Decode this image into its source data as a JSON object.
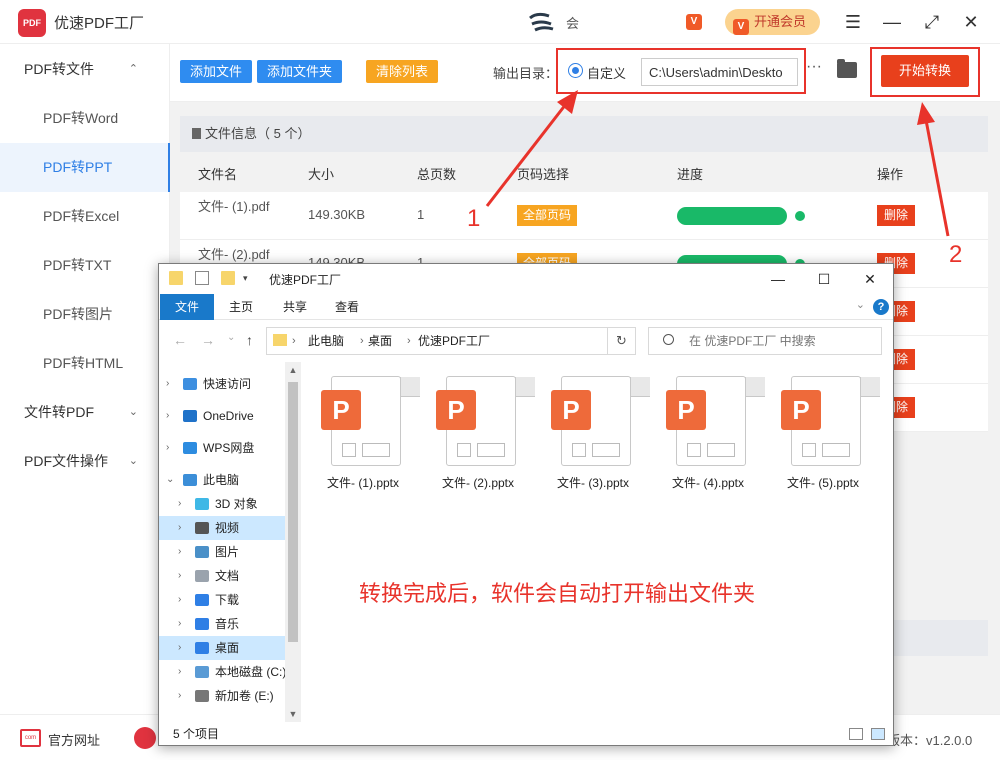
{
  "app": {
    "title": "优速PDF工厂",
    "logo_text": "PDF",
    "user_name": "会",
    "vip_label": "开通会员",
    "vip_icon": "V"
  },
  "window_controls": {
    "menu": "☰",
    "minimize": "—",
    "maximize": "⤢",
    "close": "✕"
  },
  "sidebar": {
    "groups": [
      {
        "label": "PDF转文件",
        "chevron": "⌃"
      },
      {
        "label": "文件转PDF",
        "chevron": "⌄"
      },
      {
        "label": "PDF文件操作",
        "chevron": "⌄"
      }
    ],
    "items": [
      {
        "label": "PDF转Word"
      },
      {
        "label": "PDF转PPT"
      },
      {
        "label": "PDF转Excel"
      },
      {
        "label": "PDF转TXT"
      },
      {
        "label": "PDF转图片"
      },
      {
        "label": "PDF转HTML"
      }
    ]
  },
  "toolbar": {
    "add_file": "添加文件",
    "add_folder": "添加文件夹",
    "clear_list": "清除列表",
    "output_label": "输出目录：",
    "custom_label": "自定义",
    "output_path": "C:\\Users\\admin\\Deskto",
    "more": "···",
    "start": "开始转换"
  },
  "file_list": {
    "info_title": "文件信息（ 5 个）",
    "headers": [
      "文件名",
      "大小",
      "总页数",
      "页码选择",
      "进度",
      "操作"
    ],
    "rows": [
      {
        "name": "文件- (1).pdf",
        "size": "149.30KB",
        "pages": "1",
        "page_select": "全部页码",
        "progress": 1.0,
        "action": "删除"
      },
      {
        "name": "文件- (2).pdf",
        "size": "149.30KB",
        "pages": "1",
        "page_select": "全部页码",
        "progress": 1.0,
        "action": "删除"
      }
    ],
    "hidden_row_actions": [
      "删除",
      "删除",
      "删除"
    ]
  },
  "status_bar": {
    "site_icon": "com",
    "site_link": "官方网址",
    "version": "版本：v1.2.0.0"
  },
  "explorer": {
    "title": "优速PDF工厂",
    "ribbon_tabs": [
      "文件",
      "主页",
      "共享",
      "查看"
    ],
    "help": "?",
    "breadcrumb": [
      "此电脑",
      "桌面",
      "优速PDF工厂"
    ],
    "search_placeholder": "在 优速PDF工厂 中搜索",
    "tree": [
      {
        "label": "快速访问",
        "icon": "star-icon",
        "color": "#3d8fe0"
      },
      {
        "label": "OneDrive",
        "icon": "cloud-icon",
        "color": "#1f72c9"
      },
      {
        "label": "WPS网盘",
        "icon": "cloud-icon",
        "color": "#2d8ce0"
      },
      {
        "label": "此电脑",
        "icon": "computer-icon",
        "color": "#3b8ed8"
      },
      {
        "label": "3D 对象",
        "icon": "cube-icon",
        "color": "#3fb8e6"
      },
      {
        "label": "视频",
        "icon": "film-icon",
        "color": "#555555"
      },
      {
        "label": "图片",
        "icon": "image-icon",
        "color": "#4a90c8"
      },
      {
        "label": "文档",
        "icon": "document-icon",
        "color": "#9aa3ad"
      },
      {
        "label": "下载",
        "icon": "download-icon",
        "color": "#2f7fe5"
      },
      {
        "label": "音乐",
        "icon": "music-icon",
        "color": "#2f7fe5"
      },
      {
        "label": "桌面",
        "icon": "desktop-icon",
        "color": "#2f7fe5"
      },
      {
        "label": "本地磁盘 (C:)",
        "icon": "drive-icon",
        "color": "#5a9bd5"
      },
      {
        "label": "新加卷 (E:)",
        "icon": "drive-icon",
        "color": "#777777"
      }
    ],
    "files": [
      "文件- (1).pptx",
      "文件- (2).pptx",
      "文件- (3).pptx",
      "文件- (4).pptx",
      "文件- (5).pptx"
    ],
    "ppt_letter": "P",
    "note": "转换完成后，软件会自动打开输出文件夹",
    "item_count": "5 个项目"
  },
  "annotations": {
    "one": "1",
    "two": "2"
  },
  "colors": {
    "accent": "#2f7fe5",
    "start_button": "#e8401c",
    "page_select": "#f7a521",
    "progress": "#19b968",
    "annotation": "#e8332b"
  }
}
